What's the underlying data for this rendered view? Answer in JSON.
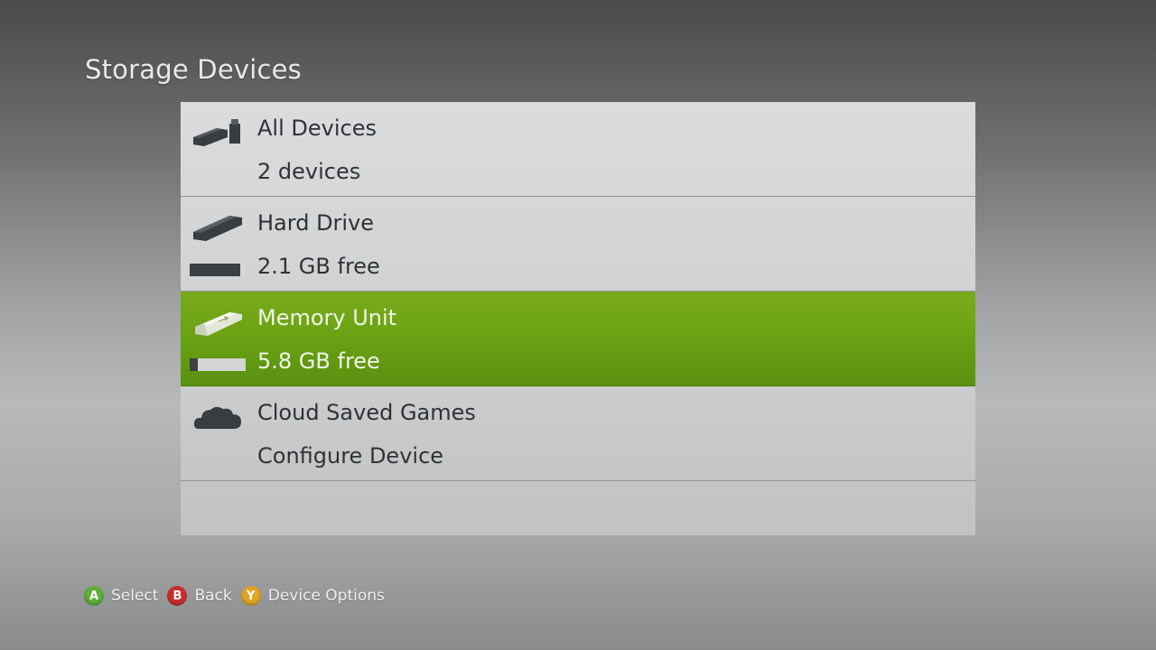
{
  "header": {
    "title": "Storage Devices"
  },
  "colors": {
    "selected_row": "#6ba314",
    "button_a": "#5fae3a",
    "button_b": "#c9302c",
    "button_y": "#e2a524",
    "icon_dark": "#3a3d40",
    "icon_light": "#e3e8d5"
  },
  "devices": [
    {
      "title": "All Devices",
      "subtitle": "2 devices",
      "icon": "all-devices-icon",
      "selected": false
    },
    {
      "title": "Hard Drive",
      "subtitle": "2.1 GB free",
      "icon": "hard-drive-icon",
      "selected": false,
      "used_fraction": 0.9
    },
    {
      "title": "Memory Unit",
      "subtitle": "5.8 GB free",
      "icon": "memory-unit-icon",
      "selected": true,
      "used_fraction": 0.14
    },
    {
      "title": "Cloud Saved Games",
      "subtitle": "Configure Device",
      "icon": "cloud-icon",
      "selected": false
    }
  ],
  "footer": {
    "hints": [
      {
        "glyph": "A",
        "label": "Select"
      },
      {
        "glyph": "B",
        "label": "Back"
      },
      {
        "glyph": "Y",
        "label": "Device Options"
      }
    ]
  }
}
